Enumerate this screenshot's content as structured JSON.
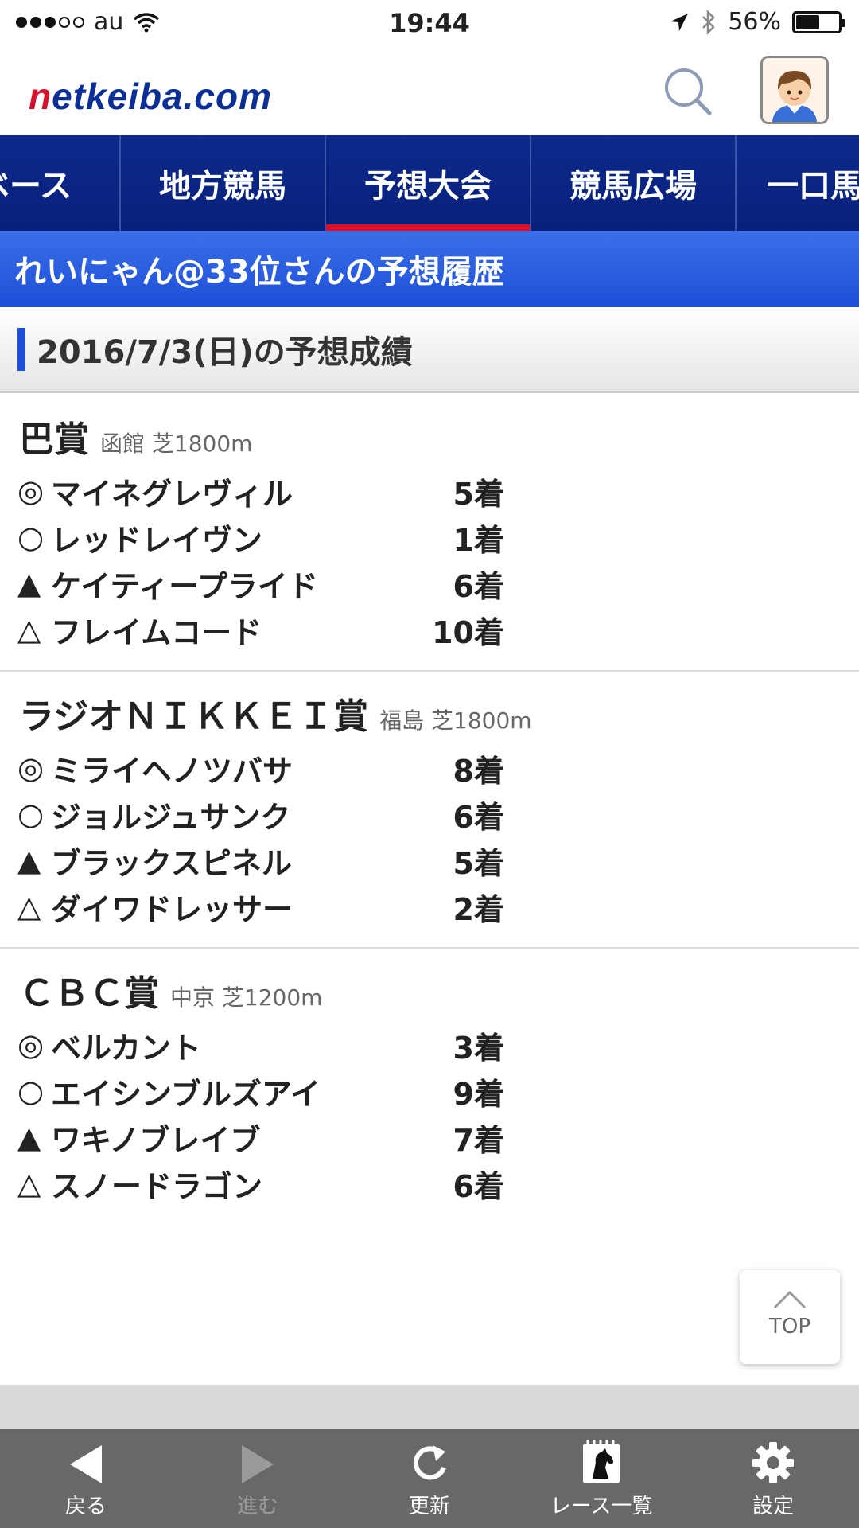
{
  "status_bar": {
    "carrier": "au",
    "time": "19:44",
    "battery": "56%",
    "battery_level": 0.56
  },
  "header": {
    "logo_text": "netkeiba.com",
    "search_icon": "search-icon",
    "avatar_icon": "user-avatar-icon"
  },
  "nav": {
    "items": [
      {
        "label": "ベース"
      },
      {
        "label": "地方競馬"
      },
      {
        "label": "予想大会",
        "active": true
      },
      {
        "label": "競馬広場"
      },
      {
        "label": "一口馬"
      }
    ]
  },
  "page": {
    "title": "れいにゃん@33位さんの予想履歴",
    "section": "2016/7/3(日)の予想成績"
  },
  "races": [
    {
      "name": "巴賞",
      "venue": "函館 芝1800m",
      "picks": [
        {
          "mark": "◎",
          "horse": "マイネグレヴィル",
          "result": "5着"
        },
        {
          "mark": "○",
          "horse": "レッドレイヴン",
          "result": "1着"
        },
        {
          "mark": "▲",
          "horse": "ケイティープライド",
          "result": "6着"
        },
        {
          "mark": "△",
          "horse": "フレイムコード",
          "result": "10着"
        }
      ]
    },
    {
      "name": "ラジオＮＩＫＫＥＩ賞",
      "venue": "福島 芝1800m",
      "picks": [
        {
          "mark": "◎",
          "horse": "ミライヘノツバサ",
          "result": "8着"
        },
        {
          "mark": "○",
          "horse": "ジョルジュサンク",
          "result": "6着"
        },
        {
          "mark": "▲",
          "horse": "ブラックスピネル",
          "result": "5着"
        },
        {
          "mark": "△",
          "horse": "ダイワドレッサー",
          "result": "2着"
        }
      ]
    },
    {
      "name": "ＣＢＣ賞",
      "venue": "中京 芝1200m",
      "picks": [
        {
          "mark": "◎",
          "horse": "ベルカント",
          "result": "3着"
        },
        {
          "mark": "○",
          "horse": "エイシンブルズアイ",
          "result": "9着"
        },
        {
          "mark": "▲",
          "horse": "ワキノブレイブ",
          "result": "7着"
        },
        {
          "mark": "△",
          "horse": "スノードラゴン",
          "result": "6着"
        }
      ]
    }
  ],
  "top_button": {
    "label": "TOP"
  },
  "toolbar": {
    "back": "戻る",
    "forward": "進む",
    "reload": "更新",
    "race_list": "レース一覧",
    "settings": "設定"
  },
  "colors": {
    "nav_bg": "#0d2a8c",
    "title_bar": "#1e4fd8",
    "accent_red": "#d6112c",
    "toolbar_bg": "#686868"
  }
}
